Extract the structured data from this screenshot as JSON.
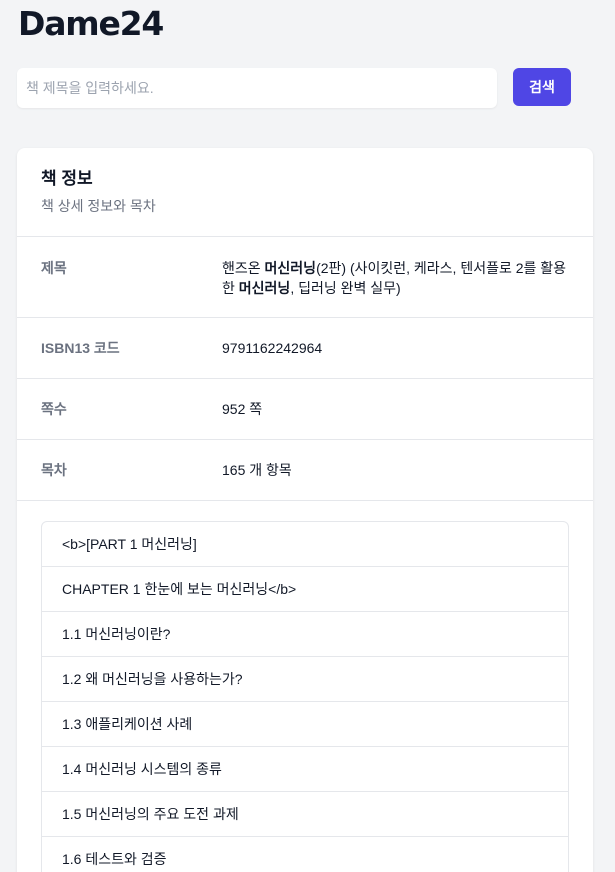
{
  "brand": {
    "logo_text": "Dame24"
  },
  "search": {
    "placeholder": "책 제목을 입력하세요.",
    "value": "",
    "button_label": "검색"
  },
  "book_card": {
    "title": "책 정보",
    "subtitle": "책 상세 정보와 목차",
    "fields": {
      "title": {
        "label": "제목",
        "segments": [
          {
            "text": "핸즈온 ",
            "bold": false
          },
          {
            "text": "머신러닝",
            "bold": true
          },
          {
            "text": "(2판) (사이킷런, 케라스, 텐서플로 2를 활용한 ",
            "bold": false
          },
          {
            "text": "머신러닝",
            "bold": true
          },
          {
            "text": ", 딥러닝 완벽 실무)",
            "bold": false
          }
        ]
      },
      "isbn": {
        "label": "ISBN13 코드",
        "value": "9791162242964"
      },
      "pages": {
        "label": "쪽수",
        "value": "952 쪽"
      },
      "toc_count": {
        "label": "목차",
        "value": "165 개 항목"
      }
    },
    "toc_items": [
      "<b>[PART 1 머신러닝]",
      "CHAPTER 1 한눈에 보는 머신러닝</b>",
      "1.1 머신러닝이란?",
      "1.2 왜 머신러닝을 사용하는가?",
      "1.3 애플리케이션 사례",
      "1.4 머신러닝 시스템의 종류",
      "1.5 머신러닝의 주요 도전 과제",
      "1.6 테스트와 검증"
    ]
  }
}
